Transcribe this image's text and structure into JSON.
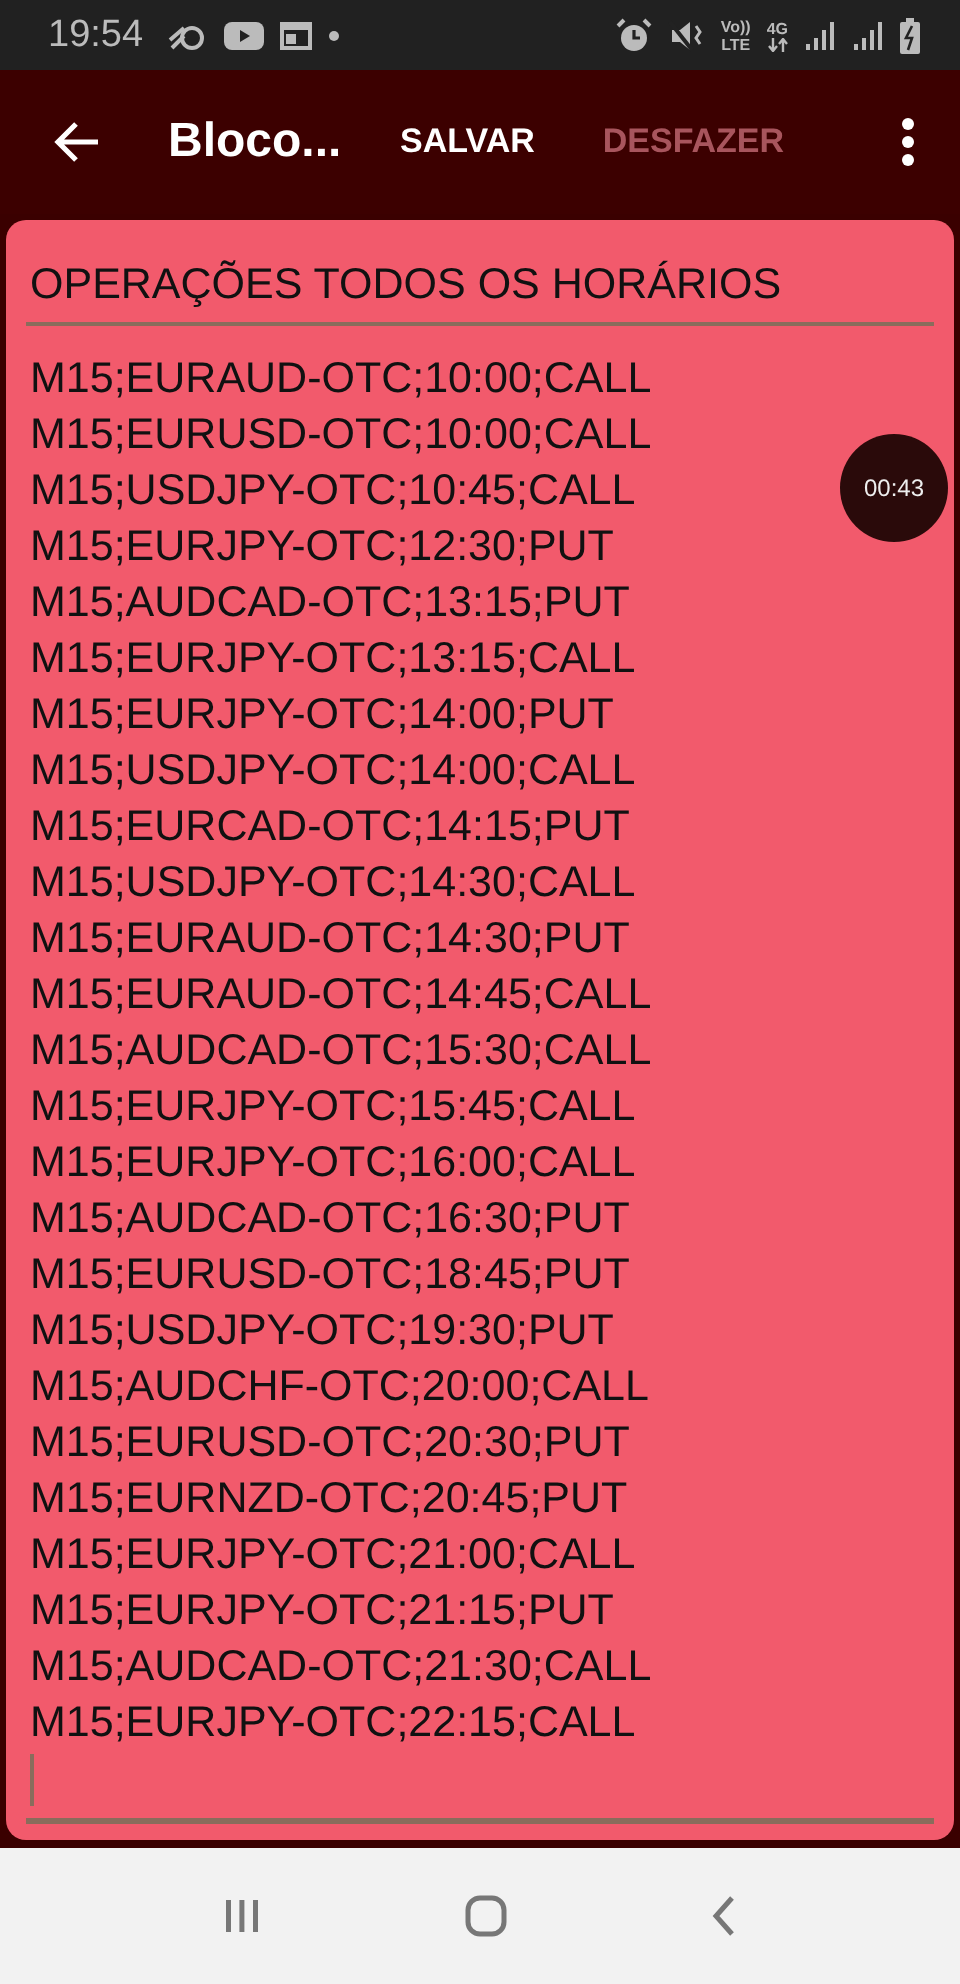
{
  "status_bar": {
    "time": "19:54",
    "volte_top": "Vo))",
    "volte_bottom": "LTE",
    "network": "4G"
  },
  "toolbar": {
    "title": "Bloco...",
    "actions": [
      {
        "label": "SALVAR",
        "disabled": false
      },
      {
        "label": "DESFAZER",
        "disabled": true
      }
    ]
  },
  "note": {
    "title": "OPERAÇÕES TODOS OS HORÁRIOS",
    "lines": [
      "M15;EURAUD-OTC;10:00;CALL",
      "M15;EURUSD-OTC;10:00;CALL",
      "M15;USDJPY-OTC;10:45;CALL",
      "M15;EURJPY-OTC;12:30;PUT",
      "M15;AUDCAD-OTC;13:15;PUT",
      "M15;EURJPY-OTC;13:15;CALL",
      "M15;EURJPY-OTC;14:00;PUT",
      "M15;USDJPY-OTC;14:00;CALL",
      "M15;EURCAD-OTC;14:15;PUT",
      "M15;USDJPY-OTC;14:30;CALL",
      "M15;EURAUD-OTC;14:30;PUT",
      "M15;EURAUD-OTC;14:45;CALL",
      "M15;AUDCAD-OTC;15:30;CALL",
      "M15;EURJPY-OTC;15:45;CALL",
      "M15;EURJPY-OTC;16:00;CALL",
      "M15;AUDCAD-OTC;16:30;PUT",
      "M15;EURUSD-OTC;18:45;PUT",
      "M15;USDJPY-OTC;19:30;PUT",
      "M15;AUDCHF-OTC;20:00;CALL",
      "M15;EURUSD-OTC;20:30;PUT",
      "M15;EURNZD-OTC;20:45;PUT",
      "M15;EURJPY-OTC;21:00;CALL",
      "M15;EURJPY-OTC;21:15;PUT",
      "M15;AUDCAD-OTC;21:30;CALL",
      "M15;EURJPY-OTC;22:15;CALL"
    ]
  },
  "timer_bubble": "00:43"
}
